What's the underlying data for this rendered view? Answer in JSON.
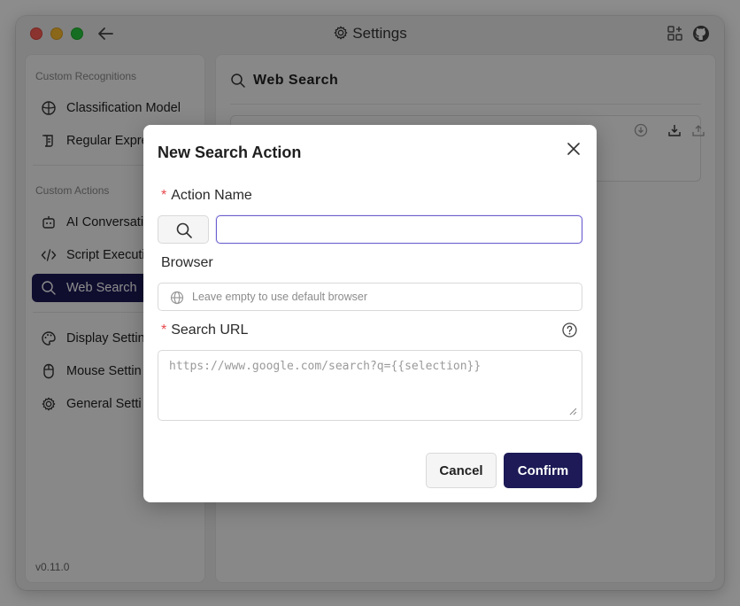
{
  "window": {
    "title": "Settings",
    "version": "v0.11.0"
  },
  "sidebar": {
    "sections": [
      {
        "title": "Custom Recognitions",
        "items": [
          {
            "label": "Classification Model",
            "icon": "brain-icon"
          },
          {
            "label": "Regular Expre",
            "icon": "scroll-icon"
          }
        ]
      },
      {
        "title": "Custom Actions",
        "items": [
          {
            "label": "AI Conversati",
            "icon": "robot-icon"
          },
          {
            "label": "Script Executi",
            "icon": "code-icon"
          },
          {
            "label": "Web Search",
            "icon": "search-icon",
            "active": true
          }
        ]
      },
      {
        "title": "",
        "items": [
          {
            "label": "Display Settin",
            "icon": "palette-icon"
          },
          {
            "label": "Mouse Settin",
            "icon": "mouse-icon"
          },
          {
            "label": "General Setti",
            "icon": "gear-icon"
          }
        ]
      }
    ]
  },
  "main": {
    "title": "Web Search"
  },
  "modal": {
    "title": "New Search Action",
    "action_name_label": "Action Name",
    "action_name_value": "",
    "browser_label": "Browser",
    "browser_placeholder": "Leave empty to use default browser",
    "search_url_label": "Search URL",
    "search_url_placeholder": "https://www.google.com/search?q={{selection}}",
    "required_mark": "*",
    "cancel_label": "Cancel",
    "confirm_label": "Confirm"
  },
  "colors": {
    "accent": "#1d1a57",
    "required": "#e5484d",
    "focus_border": "#6b5fcf"
  }
}
